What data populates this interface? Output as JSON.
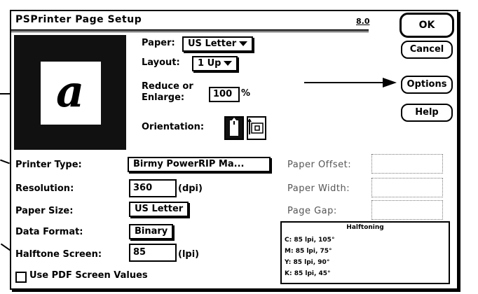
{
  "window": {
    "title": "PSPrinter Page Setup",
    "version": "8.0"
  },
  "buttons": {
    "ok": "OK",
    "cancel": "Cancel",
    "options": "Options",
    "help": "Help"
  },
  "preview": {
    "glyph": "a"
  },
  "paper": {
    "label": "Paper:",
    "value": "US Letter"
  },
  "layout": {
    "label": "Layout:",
    "value": "1 Up"
  },
  "reduce": {
    "label_line1": "Reduce or",
    "label_line2": "Enlarge:",
    "value": "100",
    "unit": "%"
  },
  "orientation": {
    "label": "Orientation:",
    "selected": "portrait"
  },
  "printer_type": {
    "label": "Printer Type:",
    "value": "Birmy PowerRIP Ma..."
  },
  "resolution": {
    "label": "Resolution:",
    "value": "360",
    "unit": "(dpi)"
  },
  "paper_size": {
    "label": "Paper Size:",
    "value": "US Letter"
  },
  "data_format": {
    "label": "Data Format:",
    "value": "Binary"
  },
  "halftone_screen": {
    "label": "Halftone Screen:",
    "value": "85",
    "unit": "(lpi)"
  },
  "use_pdf": {
    "label": "Use PDF Screen Values",
    "checked": false
  },
  "paper_offset": {
    "label": "Paper Offset:",
    "value": ""
  },
  "paper_width": {
    "label": "Paper Width:",
    "value": ""
  },
  "page_gap": {
    "label": "Page Gap:",
    "value": ""
  },
  "halftoning": {
    "title": "Halftoning",
    "lines": [
      "C: 85 lpi, 105°",
      "M: 85 lpi, 75°",
      "Y: 85 lpi, 90°",
      "K: 85 lpi, 45°"
    ]
  }
}
